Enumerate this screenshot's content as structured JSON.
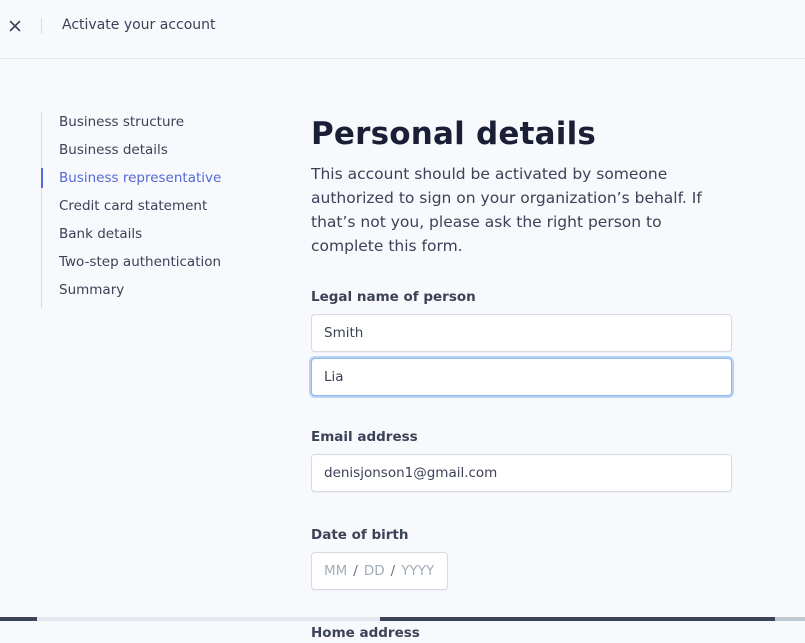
{
  "header": {
    "title": "Activate your account",
    "close_icon": "close-icon"
  },
  "steps": [
    {
      "label": "Business structure",
      "active": false
    },
    {
      "label": "Business details",
      "active": false
    },
    {
      "label": "Business representative",
      "active": true
    },
    {
      "label": "Credit card statement",
      "active": false
    },
    {
      "label": "Bank details",
      "active": false
    },
    {
      "label": "Two-step authentication",
      "active": false
    },
    {
      "label": "Summary",
      "active": false
    }
  ],
  "main": {
    "title": "Personal details",
    "intro": "This account should be activated by someone authorized to sign on your organization’s behalf. If that’s not you, please ask the right person to complete this form.",
    "legal_name": {
      "label": "Legal name of person",
      "first_value": "Smith",
      "second_value": "Lia"
    },
    "email": {
      "label": "Email address",
      "value": "denisjonson1@gmail.com"
    },
    "dob": {
      "label": "Date of birth",
      "month_placeholder": "MM",
      "day_placeholder": "DD",
      "year_placeholder": "YYYY",
      "separator": "/"
    },
    "home_address": {
      "label": "Home address"
    }
  },
  "colors": {
    "accent": "#5469d4",
    "text": "#3c4257",
    "background": "#f7f9fc",
    "focus_ring": "#8fb8f0"
  }
}
